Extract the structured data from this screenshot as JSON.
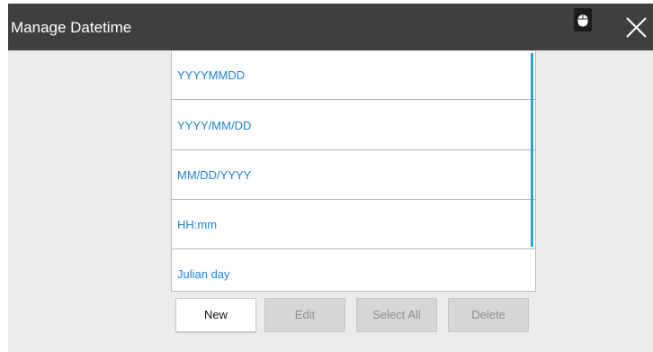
{
  "window": {
    "title": "Manage Datetime"
  },
  "titlebar_icons": {
    "mouse": "mouse-icon",
    "close": "close-icon"
  },
  "formats": [
    {
      "label": "YYYYMMDD"
    },
    {
      "label": "YYYY/MM/DD"
    },
    {
      "label": "MM/DD/YYYY"
    },
    {
      "label": "HH:mm"
    },
    {
      "label": "Julian day"
    }
  ],
  "buttons": {
    "new": "New",
    "edit": "Edit",
    "select_all": "Select All",
    "delete": "Delete"
  },
  "colors": {
    "titlebar": "#3f3f3f",
    "item_text": "#1e82d8",
    "scrollbar": "#2aa6d9",
    "background": "#ebebeb"
  }
}
